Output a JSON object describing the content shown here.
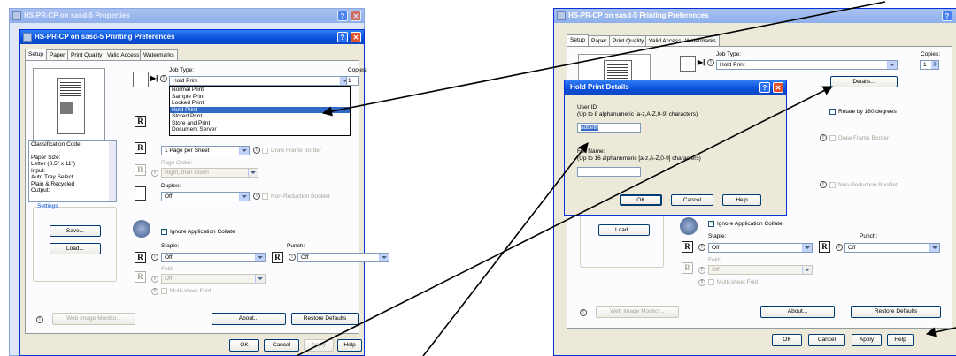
{
  "left": {
    "outer_title": "HS-PR-CP on sasd-5 Properties",
    "inner_title": "HS-PR-CP on sasd-5 Printing Preferences",
    "tabs": [
      "Setup",
      "Paper",
      "Print Quality",
      "Valid Access",
      "Watermarks"
    ],
    "job_type_label": "Job Type:",
    "job_type_value": "Hold Print",
    "copies_label": "Copies:",
    "copies_value": "1",
    "job_type_options": [
      "Normal Print",
      "Sample Print",
      "Locked Print",
      "Hold Print",
      "Stored Print",
      "Store and Print",
      "Document Server"
    ],
    "pages_per_sheet": "1 Page per Sheet",
    "draw_frame_border": "Draw Frame Border",
    "page_order_label": "Page Order:",
    "page_order_value": "Right, then Down",
    "duplex_label": "Duplex:",
    "duplex_value": "Off",
    "non_reduction_booklet": "Non-Reduction Booklet",
    "info_list": [
      "Classification Code:",
      "",
      "Paper Size:",
      "Letter (8.5\" x 11\")",
      "Input:",
      "Auto Tray Select",
      "Plain & Recycled",
      "Output:"
    ],
    "settings_label": "Settings",
    "save_button": "Save...",
    "load_button": "Load...",
    "ignore_collate": "Ignore Application Collate",
    "staple_label": "Staple:",
    "staple_value": "Off",
    "punch_label": "Punch:",
    "punch_value": "Off",
    "fold_label": "Fold:",
    "fold_value": "Off",
    "multisheet_fold": "Multi-sheet Fold",
    "web_monitor": "Web Image Monitor...",
    "about": "About...",
    "restore": "Restore Defaults",
    "ok": "OK",
    "cancel": "Cancel",
    "apply": "Apply",
    "help": "Help"
  },
  "right": {
    "outer_title": "HS-PR-CP on sasd-5 Printing Preferences",
    "tabs": [
      "Setup",
      "Paper",
      "Print Quality",
      "Valid Access",
      "Watermarks"
    ],
    "job_type_label": "Job Type:",
    "job_type_value": "Hold Print",
    "copies_label": "Copies:",
    "copies_value": "1",
    "details_button": "Details...",
    "rotate_180": "Rotate by 180 degrees",
    "draw_frame_border": "Draw Frame Border",
    "non_reduction_booklet": "Non-Reduction Booklet",
    "load_button": "Load...",
    "ignore_collate": "Ignore Application Collate",
    "staple_label": "Staple:",
    "staple_value": "Off",
    "punch_label": "Punch:",
    "punch_value": "Off",
    "fold_label": "Fold:",
    "fold_value": "Off",
    "multisheet_fold": "Multi-sheet Fold",
    "web_monitor": "Web Image Monitor...",
    "about": "About...",
    "restore": "Restore Defaults",
    "ok": "OK",
    "cancel": "Cancel",
    "apply": "Apply",
    "help": "Help"
  },
  "dialog": {
    "title": "Hold Print Details",
    "user_id_label": "User ID:",
    "user_id_hint": "(Up to 8 alphanumeric [a-z,A-Z,0-9] characters)",
    "user_id_value": "adbeth",
    "file_name_label": "File Name:",
    "file_name_hint": "(Up to 16 alphanumeric [a-z,A-Z,0-9] characters)",
    "file_name_value": "",
    "ok": "OK",
    "cancel": "Cancel",
    "help": "Help"
  }
}
